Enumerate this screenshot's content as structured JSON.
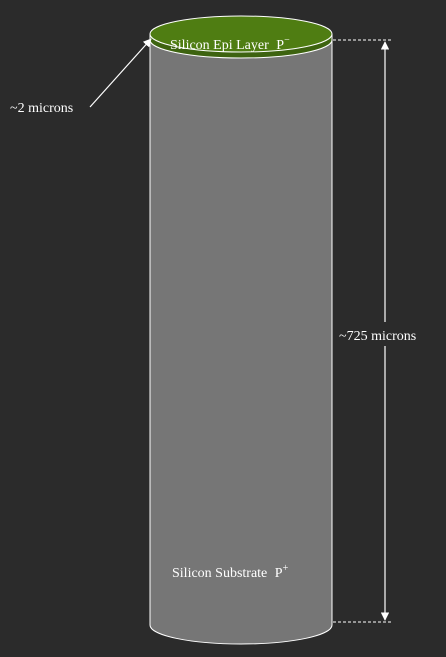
{
  "diagram": {
    "epi_label": {
      "text": "Silicon Epi Layer",
      "type": "P",
      "sup": "−"
    },
    "substrate_label": {
      "text": "Silicon Substrate",
      "type": "P",
      "sup": "+"
    },
    "epi_thickness": "~2 microns",
    "substrate_thickness": "~725 microns"
  },
  "colors": {
    "background": "#2b2b2b",
    "substrate": "#767676",
    "epi_layer": "#4f7d12",
    "outline": "#ffffff"
  }
}
